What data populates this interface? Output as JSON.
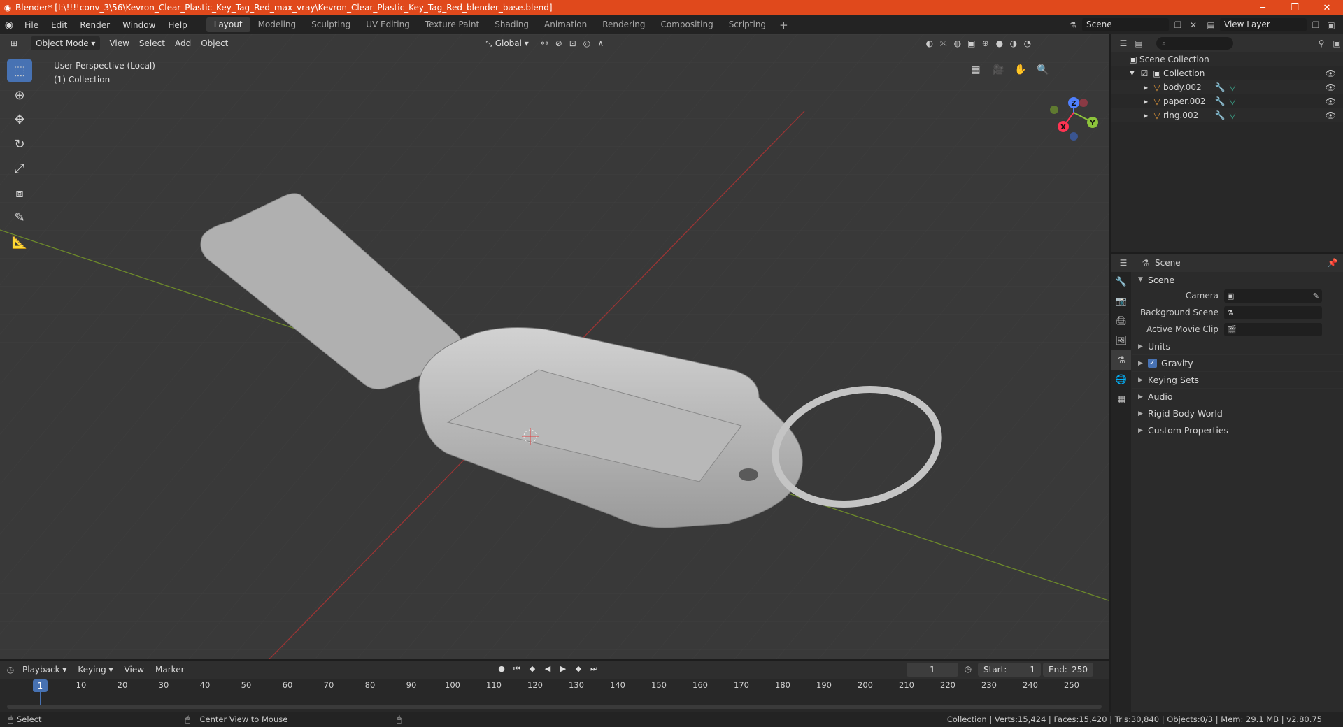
{
  "window": {
    "title": "Blender* [I:\\!!!!conv_3\\56\\Kevron_Clear_Plastic_Key_Tag_Red_max_vray\\Kevron_Clear_Plastic_Key_Tag_Red_blender_base.blend]",
    "min": "─",
    "max": "❐",
    "close": "✕"
  },
  "menu": [
    "File",
    "Edit",
    "Render",
    "Window",
    "Help"
  ],
  "workspaces": [
    "Layout",
    "Modeling",
    "Sculpting",
    "UV Editing",
    "Texture Paint",
    "Shading",
    "Animation",
    "Rendering",
    "Compositing",
    "Scripting"
  ],
  "active_workspace": "Layout",
  "scene_name": "Scene",
  "view_layer": "View Layer",
  "viewport": {
    "mode": "Object Mode",
    "menus": [
      "View",
      "Select",
      "Add",
      "Object"
    ],
    "transform_orientation": "Global",
    "info_line1": "User Perspective (Local)",
    "info_line2": "(1) Collection",
    "gizmo_labels": {
      "x": "X",
      "y": "Y",
      "z": "Z"
    }
  },
  "outliner": {
    "root": "Scene Collection",
    "collection": "Collection",
    "objects": [
      "body.002",
      "paper.002",
      "ring.002"
    ]
  },
  "properties": {
    "header": "Scene",
    "section": "Scene",
    "camera_label": "Camera",
    "bg_scene_label": "Background Scene",
    "movie_clip_label": "Active Movie Clip",
    "subsections": [
      "Units",
      "Gravity",
      "Keying Sets",
      "Audio",
      "Rigid Body World",
      "Custom Properties"
    ]
  },
  "timeline": {
    "menus": [
      "Playback",
      "Keying",
      "View",
      "Marker"
    ],
    "current_frame": "1",
    "start_label": "Start:",
    "start": "1",
    "end_label": "End:",
    "end": "250",
    "ticks": [
      "10",
      "20",
      "30",
      "40",
      "50",
      "60",
      "70",
      "80",
      "90",
      "100",
      "110",
      "120",
      "130",
      "140",
      "150",
      "160",
      "170",
      "180",
      "190",
      "200",
      "210",
      "220",
      "230",
      "240",
      "250"
    ]
  },
  "status": {
    "select": "Select",
    "center_view": "Center View to Mouse",
    "stats": "Collection | Verts:15,424 | Faces:15,420 | Tris:30,840 | Objects:0/3 | Mem: 29.1 MB | v2.80.75"
  }
}
